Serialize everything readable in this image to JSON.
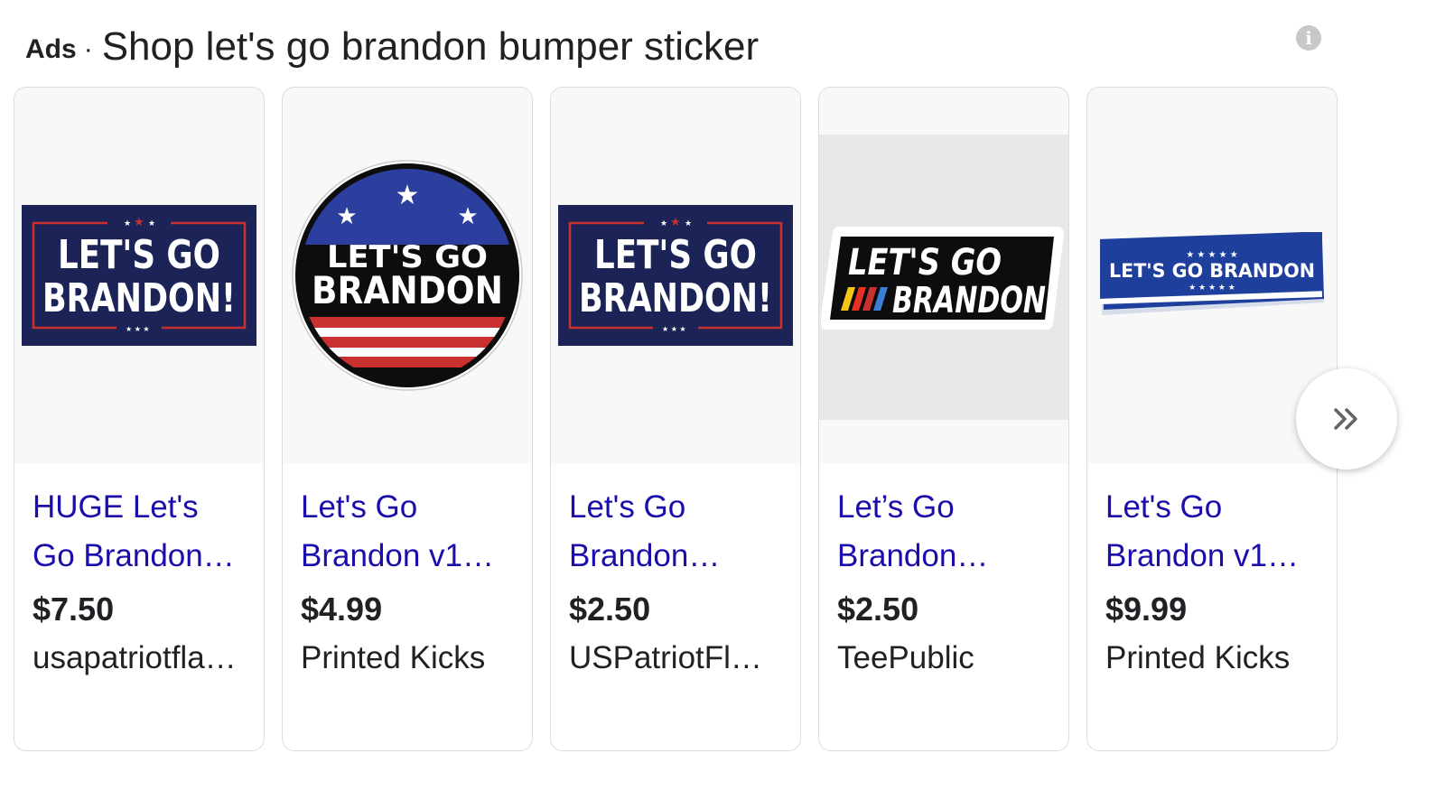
{
  "header": {
    "ads_label": "Ads",
    "separator": "·",
    "title": "Shop let's go brandon bumper sticker",
    "info_icon": "info-icon"
  },
  "products": [
    {
      "title_line1": "HUGE Let's",
      "title_line2": "Go Brandon…",
      "price": "$7.50",
      "merchant": "usapatriotfla…",
      "image": {
        "type": "flag-rect",
        "line1": "LET'S GO",
        "line2": "BRANDON!"
      }
    },
    {
      "title_line1": "Let's Go",
      "title_line2": "Brandon v1…",
      "price": "$4.99",
      "merchant": "Printed Kicks",
      "image": {
        "type": "circle",
        "line1": "LET'S GO",
        "line2": "BRANDON"
      }
    },
    {
      "title_line1": "Let's Go",
      "title_line2": "Brandon…",
      "price": "$2.50",
      "merchant": "USPatriotFl…",
      "image": {
        "type": "flag-rect",
        "line1": "LET'S GO",
        "line2": "BRANDON!"
      }
    },
    {
      "title_line1": "Let’s Go",
      "title_line2": "Brandon…",
      "price": "$2.50",
      "merchant": "TeePublic",
      "image": {
        "type": "racing",
        "line1": "LET'S GO",
        "line2": "BRANDON"
      }
    },
    {
      "title_line1": "Let's Go",
      "title_line2": "Brandon v1…",
      "price": "$9.99",
      "merchant": "Printed Kicks",
      "image": {
        "type": "bumper",
        "line1": "LET'S GO BRANDON"
      }
    }
  ],
  "next_button_icon": "double-chevron-right-icon",
  "colors": {
    "navy": "#1c2457",
    "red": "#c8312f",
    "link": "#1a0dab",
    "text": "#202124",
    "bumper_blue": "#1e3f9c"
  }
}
